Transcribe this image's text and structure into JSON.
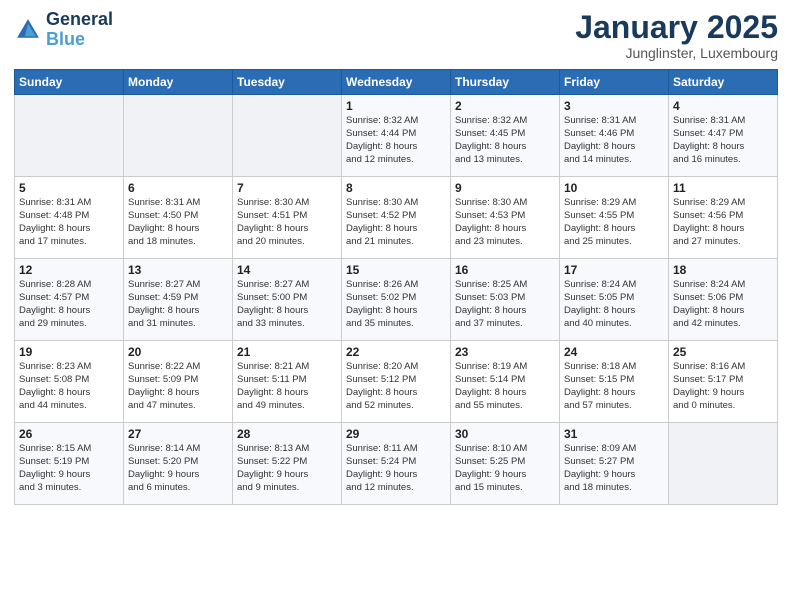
{
  "header": {
    "logo_line1": "General",
    "logo_line2": "Blue",
    "month": "January 2025",
    "location": "Junglinster, Luxembourg"
  },
  "weekdays": [
    "Sunday",
    "Monday",
    "Tuesday",
    "Wednesday",
    "Thursday",
    "Friday",
    "Saturday"
  ],
  "weeks": [
    [
      {
        "day": "",
        "info": ""
      },
      {
        "day": "",
        "info": ""
      },
      {
        "day": "",
        "info": ""
      },
      {
        "day": "1",
        "info": "Sunrise: 8:32 AM\nSunset: 4:44 PM\nDaylight: 8 hours\nand 12 minutes."
      },
      {
        "day": "2",
        "info": "Sunrise: 8:32 AM\nSunset: 4:45 PM\nDaylight: 8 hours\nand 13 minutes."
      },
      {
        "day": "3",
        "info": "Sunrise: 8:31 AM\nSunset: 4:46 PM\nDaylight: 8 hours\nand 14 minutes."
      },
      {
        "day": "4",
        "info": "Sunrise: 8:31 AM\nSunset: 4:47 PM\nDaylight: 8 hours\nand 16 minutes."
      }
    ],
    [
      {
        "day": "5",
        "info": "Sunrise: 8:31 AM\nSunset: 4:48 PM\nDaylight: 8 hours\nand 17 minutes."
      },
      {
        "day": "6",
        "info": "Sunrise: 8:31 AM\nSunset: 4:50 PM\nDaylight: 8 hours\nand 18 minutes."
      },
      {
        "day": "7",
        "info": "Sunrise: 8:30 AM\nSunset: 4:51 PM\nDaylight: 8 hours\nand 20 minutes."
      },
      {
        "day": "8",
        "info": "Sunrise: 8:30 AM\nSunset: 4:52 PM\nDaylight: 8 hours\nand 21 minutes."
      },
      {
        "day": "9",
        "info": "Sunrise: 8:30 AM\nSunset: 4:53 PM\nDaylight: 8 hours\nand 23 minutes."
      },
      {
        "day": "10",
        "info": "Sunrise: 8:29 AM\nSunset: 4:55 PM\nDaylight: 8 hours\nand 25 minutes."
      },
      {
        "day": "11",
        "info": "Sunrise: 8:29 AM\nSunset: 4:56 PM\nDaylight: 8 hours\nand 27 minutes."
      }
    ],
    [
      {
        "day": "12",
        "info": "Sunrise: 8:28 AM\nSunset: 4:57 PM\nDaylight: 8 hours\nand 29 minutes."
      },
      {
        "day": "13",
        "info": "Sunrise: 8:27 AM\nSunset: 4:59 PM\nDaylight: 8 hours\nand 31 minutes."
      },
      {
        "day": "14",
        "info": "Sunrise: 8:27 AM\nSunset: 5:00 PM\nDaylight: 8 hours\nand 33 minutes."
      },
      {
        "day": "15",
        "info": "Sunrise: 8:26 AM\nSunset: 5:02 PM\nDaylight: 8 hours\nand 35 minutes."
      },
      {
        "day": "16",
        "info": "Sunrise: 8:25 AM\nSunset: 5:03 PM\nDaylight: 8 hours\nand 37 minutes."
      },
      {
        "day": "17",
        "info": "Sunrise: 8:24 AM\nSunset: 5:05 PM\nDaylight: 8 hours\nand 40 minutes."
      },
      {
        "day": "18",
        "info": "Sunrise: 8:24 AM\nSunset: 5:06 PM\nDaylight: 8 hours\nand 42 minutes."
      }
    ],
    [
      {
        "day": "19",
        "info": "Sunrise: 8:23 AM\nSunset: 5:08 PM\nDaylight: 8 hours\nand 44 minutes."
      },
      {
        "day": "20",
        "info": "Sunrise: 8:22 AM\nSunset: 5:09 PM\nDaylight: 8 hours\nand 47 minutes."
      },
      {
        "day": "21",
        "info": "Sunrise: 8:21 AM\nSunset: 5:11 PM\nDaylight: 8 hours\nand 49 minutes."
      },
      {
        "day": "22",
        "info": "Sunrise: 8:20 AM\nSunset: 5:12 PM\nDaylight: 8 hours\nand 52 minutes."
      },
      {
        "day": "23",
        "info": "Sunrise: 8:19 AM\nSunset: 5:14 PM\nDaylight: 8 hours\nand 55 minutes."
      },
      {
        "day": "24",
        "info": "Sunrise: 8:18 AM\nSunset: 5:15 PM\nDaylight: 8 hours\nand 57 minutes."
      },
      {
        "day": "25",
        "info": "Sunrise: 8:16 AM\nSunset: 5:17 PM\nDaylight: 9 hours\nand 0 minutes."
      }
    ],
    [
      {
        "day": "26",
        "info": "Sunrise: 8:15 AM\nSunset: 5:19 PM\nDaylight: 9 hours\nand 3 minutes."
      },
      {
        "day": "27",
        "info": "Sunrise: 8:14 AM\nSunset: 5:20 PM\nDaylight: 9 hours\nand 6 minutes."
      },
      {
        "day": "28",
        "info": "Sunrise: 8:13 AM\nSunset: 5:22 PM\nDaylight: 9 hours\nand 9 minutes."
      },
      {
        "day": "29",
        "info": "Sunrise: 8:11 AM\nSunset: 5:24 PM\nDaylight: 9 hours\nand 12 minutes."
      },
      {
        "day": "30",
        "info": "Sunrise: 8:10 AM\nSunset: 5:25 PM\nDaylight: 9 hours\nand 15 minutes."
      },
      {
        "day": "31",
        "info": "Sunrise: 8:09 AM\nSunset: 5:27 PM\nDaylight: 9 hours\nand 18 minutes."
      },
      {
        "day": "",
        "info": ""
      }
    ]
  ]
}
